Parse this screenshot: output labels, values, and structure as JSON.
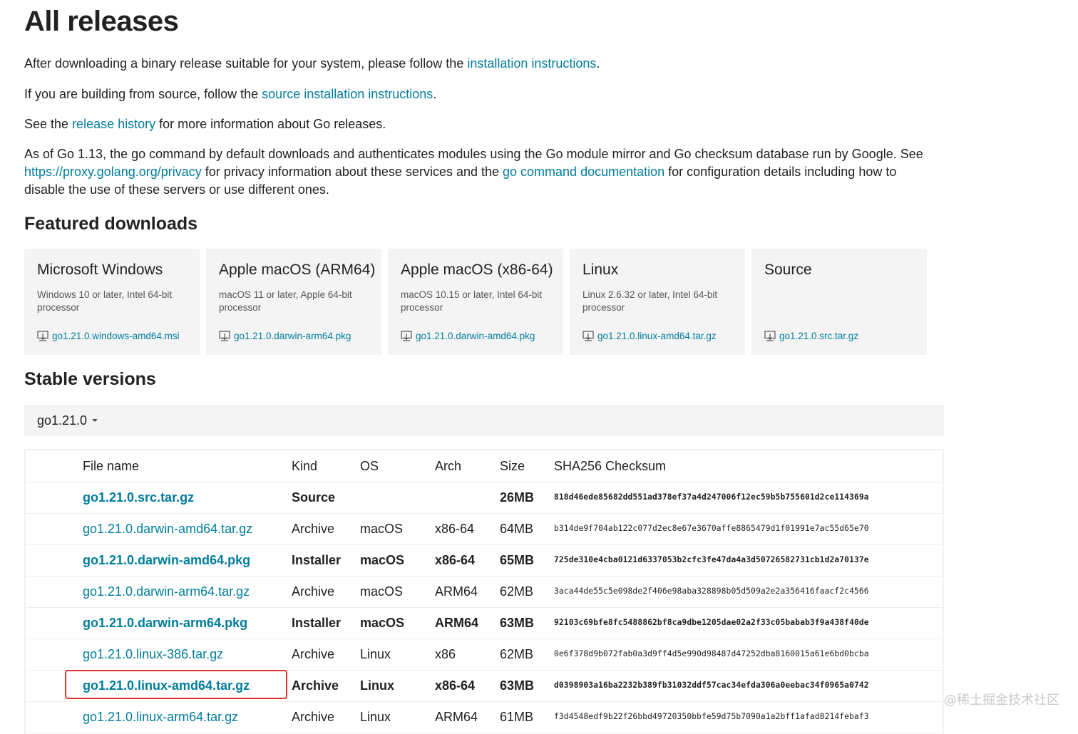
{
  "page": {
    "title": "All releases",
    "intro1": {
      "before": "After downloading a binary release suitable for your system, please follow the ",
      "link": "installation instructions",
      "after": "."
    },
    "intro2": {
      "before": "If you are building from source, follow the ",
      "link": "source installation instructions",
      "after": "."
    },
    "intro3": {
      "before": "See the ",
      "link": "release history",
      "after": " for more information about Go releases."
    },
    "intro4": {
      "line1": "As of Go 1.13, the go command by default downloads and authenticates modules using the Go module mirror and Go checksum database run by Google. See",
      "link1": "https://proxy.golang.org/privacy",
      "mid": " for privacy information about these services and the ",
      "link2": "go command documentation",
      "after": " for configuration details including how to",
      "line3": "disable the use of these servers or use different ones."
    }
  },
  "featured": {
    "heading": "Featured downloads",
    "cards": [
      {
        "title": "Microsoft Windows",
        "desc": "Windows 10 or later, Intel 64-bit processor",
        "file": "go1.21.0.windows-amd64.msi"
      },
      {
        "title": "Apple macOS (ARM64)",
        "desc": "macOS 11 or later, Apple 64-bit processor",
        "file": "go1.21.0.darwin-arm64.pkg"
      },
      {
        "title": "Apple macOS (x86-64)",
        "desc": "macOS 10.15 or later, Intel 64-bit processor",
        "file": "go1.21.0.darwin-amd64.pkg"
      },
      {
        "title": "Linux",
        "desc": "Linux 2.6.32 or later, Intel 64-bit processor",
        "file": "go1.21.0.linux-amd64.tar.gz"
      },
      {
        "title": "Source",
        "desc": "",
        "file": "go1.21.0.src.tar.gz"
      }
    ],
    "icon": "download-icon"
  },
  "stable": {
    "heading": "Stable versions",
    "version": "go1.21.0",
    "table": {
      "headers": {
        "fname": "File name",
        "kind": "Kind",
        "os": "OS",
        "arch": "Arch",
        "size": "Size",
        "sha": "SHA256 Checksum"
      },
      "rows": [
        {
          "fname": "go1.21.0.src.tar.gz",
          "kind": "Source",
          "os": "",
          "arch": "",
          "size": "26MB",
          "sha": "818d46ede85682dd551ad378ef37a4d247006f12ec59b5b755601d2ce114369a",
          "bold": true
        },
        {
          "fname": "go1.21.0.darwin-amd64.tar.gz",
          "kind": "Archive",
          "os": "macOS",
          "arch": "x86-64",
          "size": "64MB",
          "sha": "b314de9f704ab122c077d2ec8e67e3670affe8865479d1f01991e7ac55d65e70",
          "bold": false
        },
        {
          "fname": "go1.21.0.darwin-amd64.pkg",
          "kind": "Installer",
          "os": "macOS",
          "arch": "x86-64",
          "size": "65MB",
          "sha": "725de310e4cba0121d6337053b2cfc3fe47da4a3d50726582731cb1d2a70137e",
          "bold": true
        },
        {
          "fname": "go1.21.0.darwin-arm64.tar.gz",
          "kind": "Archive",
          "os": "macOS",
          "arch": "ARM64",
          "size": "62MB",
          "sha": "3aca44de55c5e098de2f406e98aba328898b05d509a2e2a356416faacf2c4566",
          "bold": false
        },
        {
          "fname": "go1.21.0.darwin-arm64.pkg",
          "kind": "Installer",
          "os": "macOS",
          "arch": "ARM64",
          "size": "63MB",
          "sha": "92103c69bfe8fc5488862bf8ca9dbe1205dae02a2f33c05babab3f9a438f40de",
          "bold": true
        },
        {
          "fname": "go1.21.0.linux-386.tar.gz",
          "kind": "Archive",
          "os": "Linux",
          "arch": "x86",
          "size": "62MB",
          "sha": "0e6f378d9b072fab0a3d9ff4d5e990d98487d47252dba8160015a61e6bd0bcba",
          "bold": false
        },
        {
          "fname": "go1.21.0.linux-amd64.tar.gz",
          "kind": "Archive",
          "os": "Linux",
          "arch": "x86-64",
          "size": "63MB",
          "sha": "d0398903a16ba2232b389fb31032ddf57cac34efda306a0eebac34f0965a0742",
          "bold": true
        },
        {
          "fname": "go1.21.0.linux-arm64.tar.gz",
          "kind": "Archive",
          "os": "Linux",
          "arch": "ARM64",
          "size": "61MB",
          "sha": "f3d4548edf9b22f26bbd49720350bbfe59d75b7090a1a2bff1afad8214febaf3",
          "bold": false
        }
      ]
    }
  },
  "watermark": "@稀土掘金技术社区",
  "colors": {
    "link": "#007d9c",
    "highlight": "#e0332d",
    "card_bg": "#f4f4f4"
  }
}
